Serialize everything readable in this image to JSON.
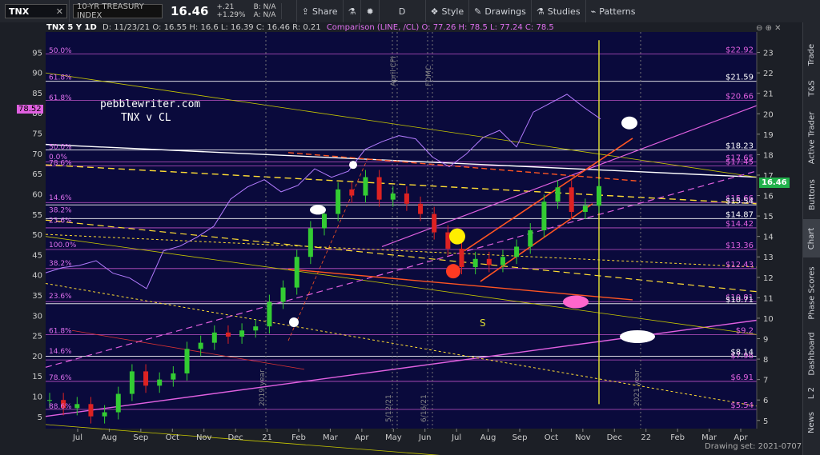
{
  "toolbar": {
    "symbol": "TNX",
    "symbol_clear_icon": "close-icon",
    "description": "10-YR TREASURY INDEX",
    "last": "16.46",
    "change_abs": "+.21",
    "change_pct": "+1.29%",
    "bid": "B: N/A",
    "ask": "A: N/A",
    "share": "Share",
    "period": "D",
    "style": "Style",
    "drawings": "Drawings",
    "studies": "Studies",
    "patterns": "Patterns"
  },
  "header": {
    "symbol_line": "TNX 5 Y 1D",
    "ohlc": "D: 11/23/21  O: 16.55  H: 16.6  L: 16.39  C: 16.46  R: 0.21",
    "comparison": "Comparison (LINE, /CL)  O: 77.26  H: 78.5  L: 77.24  C: 78.5"
  },
  "annotations": {
    "site": "pebblewriter.com",
    "subtitle": "TNX v CL",
    "s_mark": "S"
  },
  "events": [
    "April CPI",
    "FOMC",
    "5/12/21",
    "6/16/21",
    "2019 year",
    "2021 year"
  ],
  "fib_levels": [
    "50.0%",
    "61.8%",
    "61.8%",
    "50.0%",
    "0.0%",
    "78.6%",
    "14.6%",
    "38.2%",
    "23.6%",
    "100.0%",
    "38.2%",
    "23.6%",
    "61.8%",
    "14.6%",
    "78.6%",
    "88.6%"
  ],
  "right_price_tags": [
    {
      "label": "$22.92",
      "color": "#e060e0"
    },
    {
      "label": "$21.59",
      "color": "#ffffff"
    },
    {
      "label": "$20.66",
      "color": "#e060e0"
    },
    {
      "label": "$18.23",
      "color": "#ffffff"
    },
    {
      "label": "$17.65",
      "color": "#e060e0"
    },
    {
      "label": "$17.45",
      "color": "#e060e0"
    },
    {
      "label": "$15.66",
      "color": "#e060e0"
    },
    {
      "label": "$15.54",
      "color": "#ffffff"
    },
    {
      "label": "$14.87",
      "color": "#ffffff"
    },
    {
      "label": "$14.42",
      "color": "#e060e0"
    },
    {
      "label": "$13.36",
      "color": "#e060e0"
    },
    {
      "label": "$12.43",
      "color": "#e060e0"
    },
    {
      "label": "$10.81",
      "color": "#e060e0"
    },
    {
      "label": "$10.71",
      "color": "#ffffff"
    },
    {
      "label": "$9.2",
      "color": "#e060e0"
    },
    {
      "label": "$7.96",
      "color": "#e060e0"
    },
    {
      "label": "$8.14",
      "color": "#ffffff"
    },
    {
      "label": "$6.91",
      "color": "#e060e0"
    },
    {
      "label": "$5.54",
      "color": "#e060e0"
    }
  ],
  "last_price_badge": "16.46",
  "left_price_badge": "78.52",
  "footer": {
    "drawing_set": "Drawing set: 2021-0707"
  },
  "side_tabs": [
    "Trade",
    "T&S",
    "Active Trader",
    "Buttons",
    "Chart",
    "Phase Scores",
    "Dashboard",
    "L 2",
    "News"
  ],
  "colors": {
    "background": "#0a0a3c",
    "up_candle": "#33cc33",
    "down_candle": "#dd2222",
    "comparison": "#b47cff",
    "fib": "#e060e0"
  },
  "chart_data": {
    "type": "line",
    "title": "",
    "x": [
      "Jul",
      "Aug",
      "Sep",
      "Oct",
      "Nov",
      "Dec",
      "21",
      "Feb",
      "Mar",
      "Apr",
      "May",
      "Jun",
      "Jul",
      "Aug",
      "Sep",
      "Oct",
      "Nov",
      "Dec",
      "22",
      "Feb",
      "Mar",
      "Apr"
    ],
    "y_left_ticks": [
      5,
      10,
      15,
      20,
      25,
      30,
      35,
      40,
      45,
      50,
      55,
      60,
      65,
      70,
      75,
      80,
      85,
      90,
      95
    ],
    "y_right_ticks": [
      5,
      6,
      7,
      8,
      9,
      10,
      11,
      12,
      13,
      14,
      15,
      16,
      17,
      18,
      19,
      20,
      21,
      22,
      23
    ],
    "ylim_right": [
      4.6,
      24
    ],
    "ylim_left": [
      2,
      100
    ],
    "series": [
      {
        "name": "TNX",
        "values": [
          6.0,
          5.6,
          5.8,
          5.2,
          5.4,
          6.3,
          7.4,
          6.7,
          7.0,
          7.3,
          8.5,
          8.8,
          9.3,
          9.1,
          9.4,
          9.6,
          10.8,
          11.5,
          13.0,
          14.4,
          15.1,
          16.3,
          16.0,
          16.9,
          15.8,
          16.1,
          15.6,
          15.1,
          14.2,
          13.4,
          12.5,
          12.9,
          12.6,
          13.0,
          13.5,
          14.3,
          15.7,
          16.4,
          15.2,
          15.5,
          16.46
        ]
      },
      {
        "name": "/CL",
        "values": [
          40.5,
          41.8,
          42.3,
          43.5,
          40.4,
          39.2,
          36.6,
          45.9,
          47.1,
          49.3,
          52.0,
          58.7,
          61.7,
          63.5,
          60.5,
          62.1,
          66.2,
          64.1,
          65.6,
          71.0,
          72.9,
          74.4,
          73.6,
          69.1,
          66.7,
          69.8,
          73.9,
          75.7,
          71.6,
          80.2,
          82.4,
          84.6,
          81.4,
          78.5
        ]
      }
    ]
  }
}
